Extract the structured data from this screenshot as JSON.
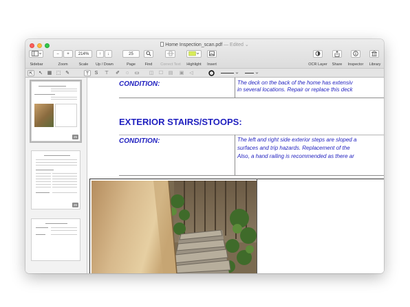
{
  "window": {
    "filename": "Home Inspection_scan.pdf",
    "edited": "— Edited ⌄"
  },
  "toolbar": {
    "sidebar_label": "Sidebar",
    "zoom_label": "Zoom",
    "zoom_out": "−",
    "zoom_in": "+",
    "scale_value": "214%",
    "scale_label": "Scale",
    "up": "↑",
    "down": "↓",
    "updown_label": "Up / Down",
    "page_value": "25",
    "page_label": "Page",
    "find_label": "Find",
    "correct_text_label": "Correct Text",
    "highlight_label": "Highlight",
    "insert_label": "Insert",
    "ocr_label": "OCR Layer",
    "share_label": "Share",
    "inspector_label": "Inspector",
    "library_label": "Library"
  },
  "sidebar": {
    "thumbnails": [
      {
        "page": "25",
        "selected": true
      },
      {
        "page": "26",
        "selected": false
      },
      {
        "page": "",
        "selected": false
      }
    ],
    "thumb_size": 0.55
  },
  "document": {
    "condition_label_1": "CONDITION:",
    "deck_line_1": "The deck on the back of the home has extensiv",
    "deck_line_2": "in several locations.  Repair or replace this deck",
    "section_heading": "EXTERIOR STAIRS/STOOPS:",
    "condition_label_2": "CONDITION:",
    "stairs_line_1": "The left and right side exterior steps are sloped a",
    "stairs_line_2": "surfaces and trip hazards.  Replacement of the",
    "stairs_line_3": "Also, a hand railing is recommended as there ar"
  },
  "colors": {
    "document_text": "#1f1fbf",
    "accent": "#3b8af5"
  }
}
